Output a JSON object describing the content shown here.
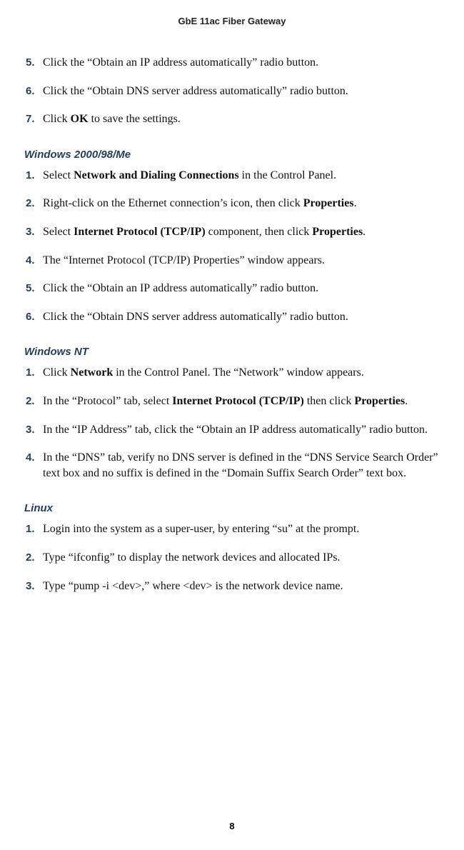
{
  "header": "GbE 11ac Fiber Gateway",
  "page_number": "8",
  "top_steps": [
    {
      "n": "5.",
      "html": "Click the “Obtain an <span class='sc'>IP</span> address automatically” radio button."
    },
    {
      "n": "6.",
      "html": "Click the “Obtain <span class='sc'>DNS</span> server address automatically” radio button."
    },
    {
      "n": "7.",
      "html": "Click <b>OK</b> to save the settings."
    }
  ],
  "sections": [
    {
      "heading": "Windows 2000/98/Me",
      "steps": [
        {
          "n": "1.",
          "html": "Select <b>Network and Dialing Connections</b> in the Control Panel."
        },
        {
          "n": "2.",
          "html": "Right-click on the Ethernet connection’s icon, then click <b>Properties</b>."
        },
        {
          "n": "3.",
          "html": "Select <b>Internet Protocol (TCP/IP)</b> component, then click <b>Properties</b>."
        },
        {
          "n": "4.",
          "html": "The “Internet Protocol (<span class='sc'>TCP/IP</span>) Properties” window appears."
        },
        {
          "n": "5.",
          "html": "Click the “Obtain an <span class='sc'>IP</span> address automatically” radio button."
        },
        {
          "n": "6.",
          "html": "Click the “Obtain <span class='sc'>DNS</span> server address automatically” radio button."
        }
      ]
    },
    {
      "heading": "Windows NT",
      "steps": [
        {
          "n": "1.",
          "html": "Click <b>Network</b> in the Control Panel. The “Network” window appears."
        },
        {
          "n": "2.",
          "html": "In the “Protocol” tab, select <b>Internet Protocol (TCP/IP)</b> then click <b>Properties</b>."
        },
        {
          "n": "3.",
          "html": "In the “<span class='sc'>IP</span> Address” tab,  click the “Obtain an <span class='sc'>IP</span> address automatically” radio button."
        },
        {
          "n": "4.",
          "html": "In the “<span class='sc'>DNS</span>” tab, verify no <span class='sc'>DNS</span> server is defined in the “<span class='sc'>DNS</span> Service Search Order” text box and no suffix is defined in the “Domain Suffix Search Order” text box."
        }
      ]
    },
    {
      "heading": "Linux",
      "steps": [
        {
          "n": "1.",
          "html": "Login into the system as a super-user, by entering “su” at the prompt."
        },
        {
          "n": "2.",
          "html": "Type “ifconfig” to display the network devices and allocated <span class='sc'>IP</span>s."
        },
        {
          "n": "3.",
          "html": "Type “pump -i &lt;dev&gt;,” where &lt;dev&gt; is the network device name."
        }
      ]
    }
  ]
}
